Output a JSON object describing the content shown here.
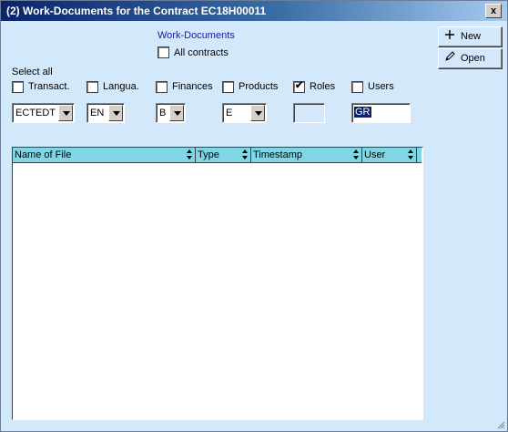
{
  "window": {
    "title": "(2) Work-Documents for the Contract EC18H00011",
    "close_label": "x"
  },
  "section": {
    "title": "Work-Documents"
  },
  "all_contracts": {
    "label": "All contracts",
    "checked": false
  },
  "select_all": {
    "label": "Select all"
  },
  "filters": [
    {
      "label": "Transact.",
      "checked": false,
      "control": "combo",
      "value": "ECTEDT"
    },
    {
      "label": "Langua.",
      "checked": false,
      "control": "combo",
      "value": "EN"
    },
    {
      "label": "Finances",
      "checked": false,
      "control": "combo",
      "value": "B"
    },
    {
      "label": "Products",
      "checked": false,
      "control": "combo",
      "value": "E"
    },
    {
      "label": "Roles",
      "checked": true,
      "control": "textbox",
      "value": ""
    },
    {
      "label": "Users",
      "checked": false,
      "control": "textbox",
      "value": "GR"
    }
  ],
  "buttons": {
    "new": {
      "label": "New",
      "icon": "plus-icon"
    },
    "open": {
      "label": "Open",
      "icon": "pencil-icon"
    }
  },
  "table": {
    "columns": [
      "Name of File",
      "Type",
      "Timestamp",
      "User"
    ],
    "rows": []
  },
  "checkmark": "✔"
}
